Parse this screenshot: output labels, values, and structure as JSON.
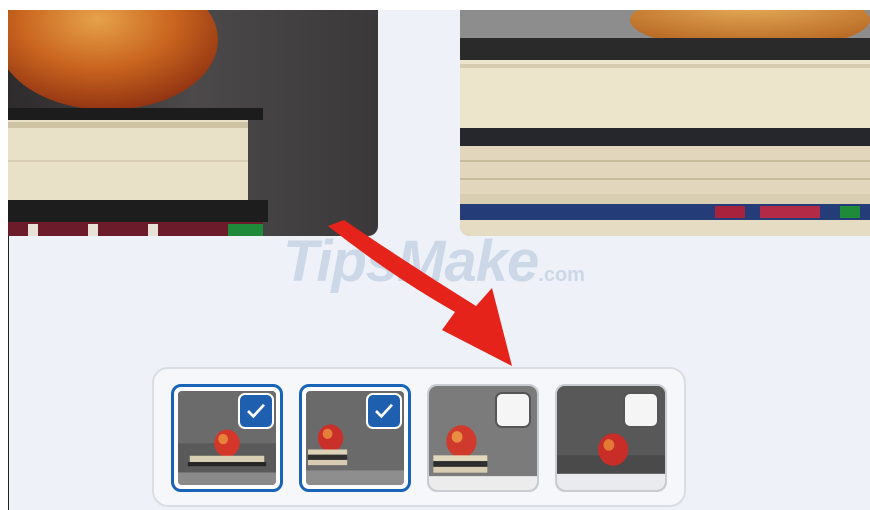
{
  "watermark": {
    "brand": "TipsMake",
    "suffix": ".com"
  },
  "colors": {
    "accent": "#1f5fb0",
    "arrow": "#e5231b",
    "background": "#eef1f8"
  },
  "photos": {
    "left": {
      "icon": "apple-on-books-photo"
    },
    "right": {
      "icon": "books-closeup-photo"
    }
  },
  "thumbnails": [
    {
      "label": "photo-1",
      "selected": true
    },
    {
      "label": "photo-2",
      "selected": true
    },
    {
      "label": "photo-3",
      "selected": false
    },
    {
      "label": "photo-4",
      "selected": false
    }
  ]
}
